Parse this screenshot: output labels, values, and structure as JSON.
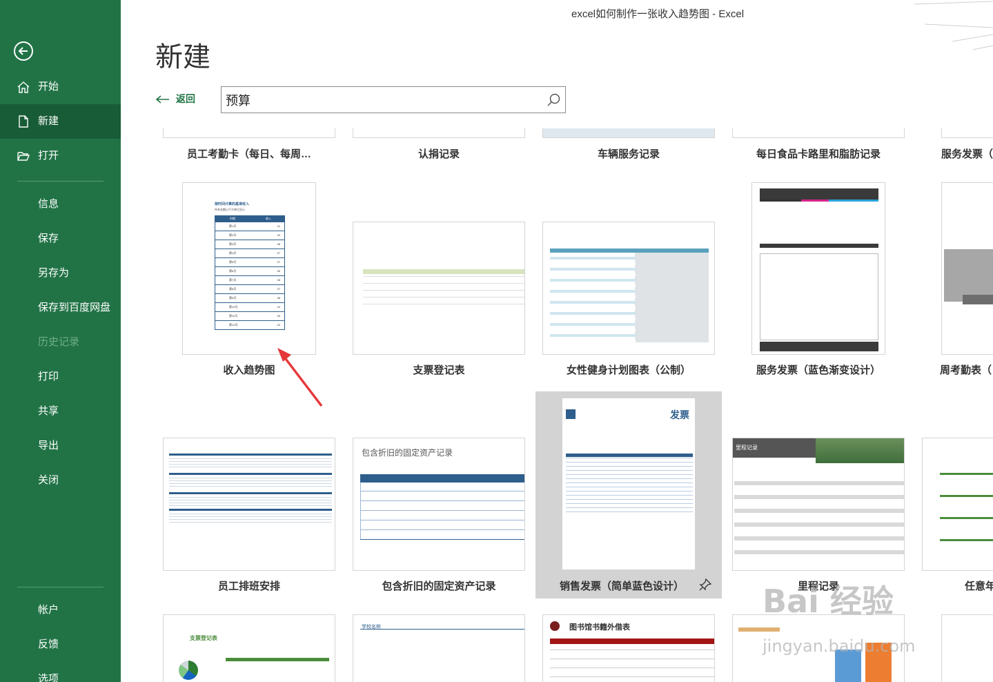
{
  "window": {
    "title": "excel如何制作一张收入趋势图  -  Excel"
  },
  "sidebar": {
    "items": [
      {
        "label": "开始",
        "icon": "home-icon"
      },
      {
        "label": "新建",
        "icon": "new-document-icon"
      },
      {
        "label": "打开",
        "icon": "folder-open-icon"
      },
      {
        "label": "信息"
      },
      {
        "label": "保存"
      },
      {
        "label": "另存为"
      },
      {
        "label": "保存到百度网盘"
      },
      {
        "label": "历史记录"
      },
      {
        "label": "打印"
      },
      {
        "label": "共享"
      },
      {
        "label": "导出"
      },
      {
        "label": "关闭"
      },
      {
        "label": "帐户"
      },
      {
        "label": "反馈"
      },
      {
        "label": "选项"
      }
    ]
  },
  "main": {
    "page_title": "新建",
    "back_label": "返回",
    "search": {
      "value": "预算"
    }
  },
  "templates": {
    "row0": [
      "员工考勤卡（每日、每周…",
      "认捐记录",
      "车辆服务记录",
      "每日食品卡路里和脂肪记录",
      "服务发票（"
    ],
    "row1": [
      "收入趋势图",
      "支票登记表",
      "女性健身计划图表（公制）",
      "服务发票（蓝色渐变设计）",
      "周考勤表（"
    ],
    "row2": [
      "员工排班安排",
      "包含折旧的固定资产记录",
      "销售发票（简单蓝色设计）",
      "里程记录",
      "任意年"
    ]
  },
  "thumb_text": {
    "income_title": "按时间计算的基准收入",
    "income_sub": "所有金额以千为单位显示",
    "income_header": [
      "时期",
      "收入"
    ],
    "income_rows": [
      [
        "第1月",
        "41"
      ],
      [
        "第2月",
        "40"
      ],
      [
        "第3月",
        "38"
      ],
      [
        "第4月",
        "37"
      ],
      [
        "第5月",
        "37"
      ],
      [
        "第6月",
        "36"
      ],
      [
        "第7月",
        "38"
      ],
      [
        "第8月",
        "37"
      ],
      [
        "第9月",
        "38"
      ],
      [
        "第10月",
        "44"
      ],
      [
        "第11月",
        "45"
      ],
      [
        "第12月",
        "42"
      ]
    ],
    "asset_title": "包含折旧的固定资产记录",
    "invoice_title": "发票",
    "mileage_title": "里程记录",
    "check_title": "支票登记表",
    "school_title": "学校名称",
    "library_title": "图书馆书籍外借表"
  },
  "watermark": {
    "line1": "Bai 经验",
    "line2": "jingyan.baidu.com"
  },
  "colors": {
    "excel_green": "#217346",
    "active_green": "#185c37",
    "accent_blue": "#2e5e8c",
    "red_arrow": "#e5383b"
  }
}
